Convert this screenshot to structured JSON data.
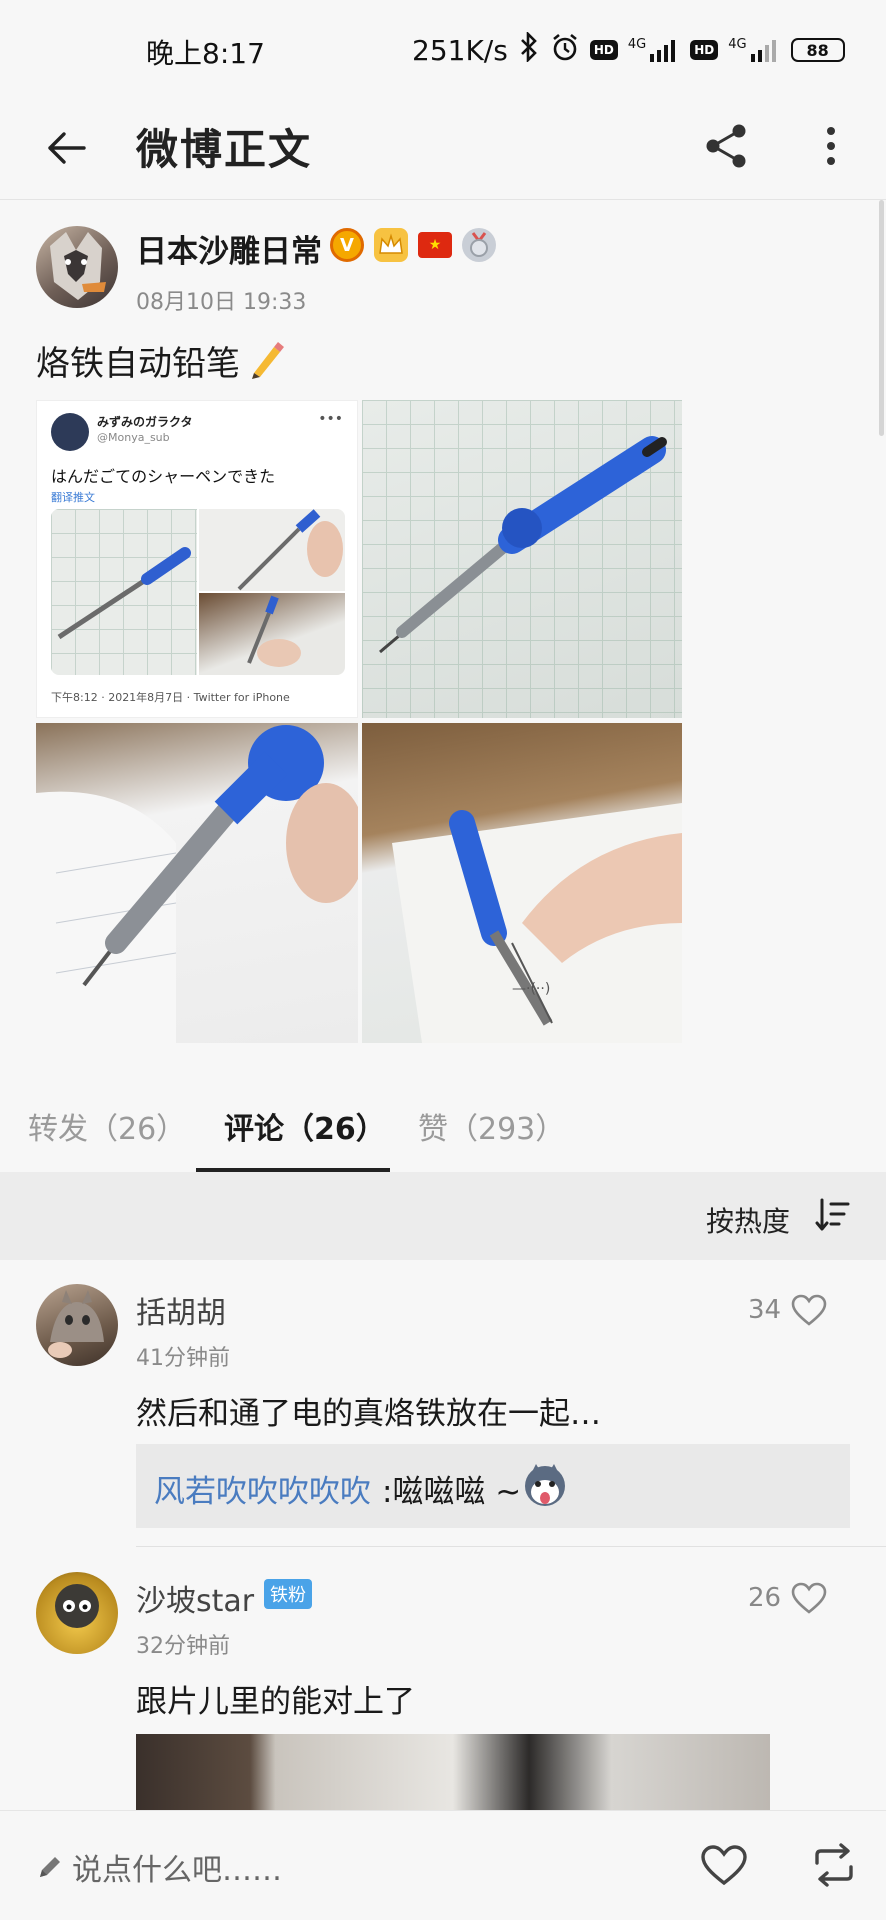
{
  "status_bar": {
    "time": "晚上8:17",
    "speed": "251K/s",
    "net1": "4G",
    "net2": "4G",
    "hd": "HD",
    "battery": "88"
  },
  "nav": {
    "title": "微博正文"
  },
  "post": {
    "author": "日本沙雕日常",
    "time": "08月10日 19:33",
    "text": "烙铁自动铅笔",
    "tweet": {
      "name": "みずみのガラクタ",
      "handle": "@Monya_sub",
      "text": "はんだごてのシャーペンできた",
      "translate": "翻译推文",
      "meta": "下午8:12 · 2021年8月7日 · Twitter for iPhone"
    }
  },
  "tabs": [
    {
      "label": "转发（26）"
    },
    {
      "label": "评论（26）"
    },
    {
      "label": "赞（293）"
    }
  ],
  "sort": {
    "label": "按热度"
  },
  "comments": [
    {
      "name": "括胡胡",
      "time": "41分钟前",
      "text": "然后和通了电的真烙铁放在一起…",
      "likes": "34",
      "reply": {
        "user": "风若吹吹吹吹吹",
        "text": ":嗞嗞嗞 ~"
      }
    },
    {
      "name": "沙坡star",
      "badge": "铁粉",
      "time": "32分钟前",
      "text": "跟片儿里的能对上了",
      "likes": "26"
    }
  ],
  "bottom": {
    "compose_placeholder": "说点什么吧……"
  }
}
